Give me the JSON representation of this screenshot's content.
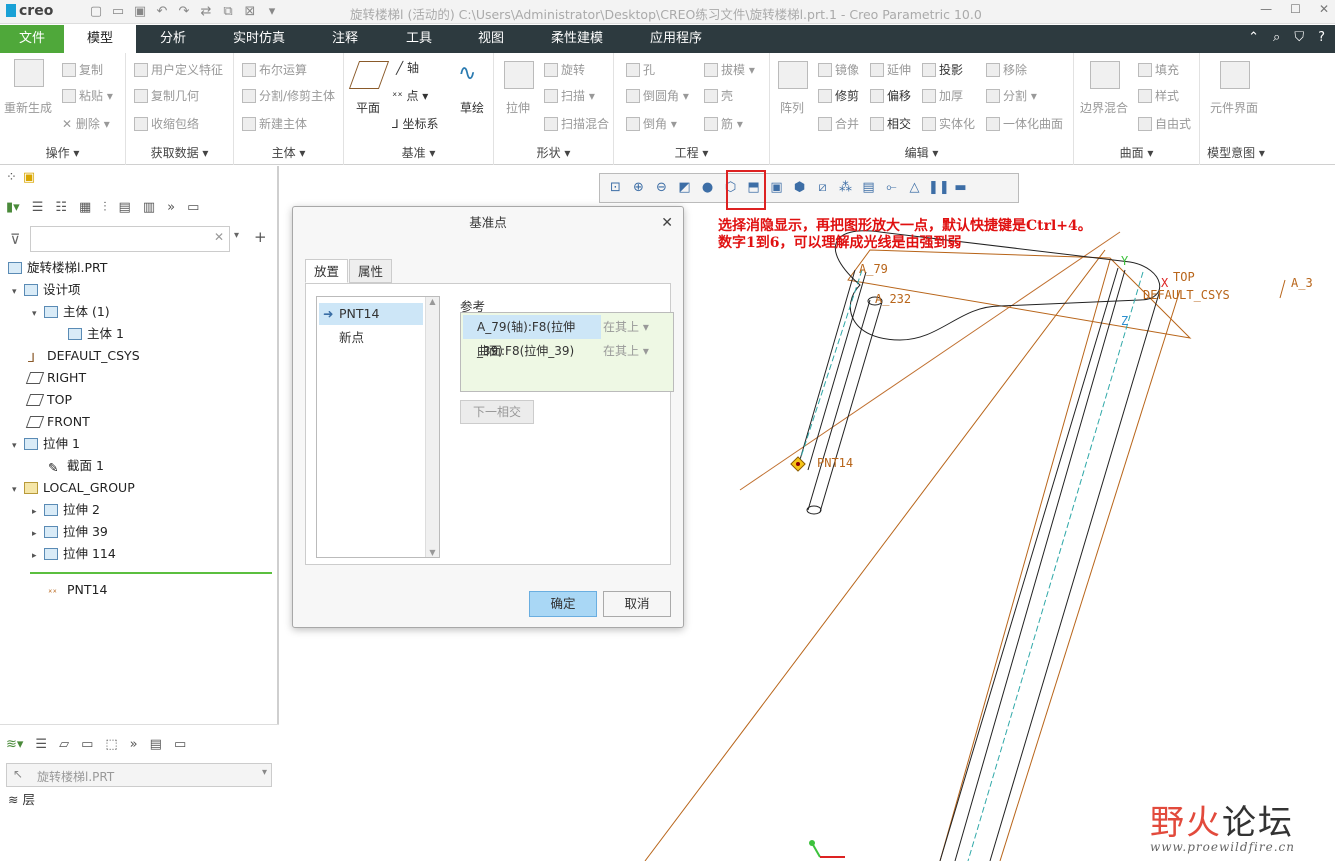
{
  "titlebar": {
    "logo": "creo",
    "title": "旋转楼梯l (活动的) C:\\Users\\Administrator\\Desktop\\CREO练习文件\\旋转楼梯l.prt.1 - Creo Parametric 10.0"
  },
  "menu": {
    "file": "文件",
    "tabs": [
      "模型",
      "分析",
      "实时仿真",
      "注释",
      "工具",
      "视图",
      "柔性建模",
      "应用程序"
    ]
  },
  "ribbon": {
    "ops": {
      "regen": "重新生成",
      "copy": "复制",
      "paste": "粘贴",
      "delete": "删除",
      "title": "操作"
    },
    "getdata": {
      "udf": "用户定义特征",
      "copygeom": "复制几何",
      "shrink": "收缩包络",
      "title": "获取数据"
    },
    "body": {
      "bool": "布尔运算",
      "split": "分割/修剪主体",
      "newbody": "新建主体",
      "title": "主体"
    },
    "datum": {
      "plane": "平面",
      "axis": "轴",
      "point": "点",
      "csys": "坐标系",
      "sketch": "草绘",
      "title": "基准"
    },
    "shape": {
      "extrude": "拉伸",
      "revolve": "旋转",
      "sweep": "扫描",
      "sweepblend": "扫描混合",
      "title": "形状"
    },
    "eng": {
      "hole": "孔",
      "round": "倒圆角",
      "chamfer": "倒角",
      "draft": "拔模",
      "shell": "壳",
      "rib": "筋",
      "title": "工程"
    },
    "edit": {
      "pattern": "阵列",
      "mirror": "镜像",
      "extend": "延伸",
      "project": "投影",
      "trim": "修剪",
      "offset": "偏移",
      "thicken": "加厚",
      "merge": "合并",
      "intersect": "相交",
      "solidify": "实体化",
      "remove": "移除",
      "split": "分割",
      "unify": "一体化曲面",
      "title": "编辑"
    },
    "surface": {
      "boundary": "边界混合",
      "fill": "填充",
      "style": "样式",
      "freeform": "自由式",
      "title": "曲面"
    },
    "intent": {
      "compiface": "元件界面",
      "title": "模型意图"
    }
  },
  "tree": {
    "nodes": [
      "旋转楼梯l.PRT",
      "设计项",
      "主体 (1)",
      "主体 1",
      "DEFAULT_CSYS",
      "RIGHT",
      "TOP",
      "FRONT",
      "拉伸 1",
      "截面 1",
      "LOCAL_GROUP",
      "拉伸 2",
      "拉伸 39",
      "拉伸 114",
      "PNT14"
    ],
    "layer_combo": "旋转楼梯l.PRT",
    "layer_label": "层"
  },
  "dialog": {
    "title": "基准点",
    "tab_place": "放置",
    "tab_props": "属性",
    "points": [
      "PNT14",
      "新点"
    ],
    "ref_label": "参考",
    "refs": [
      {
        "name": "A_79(轴):F8(拉伸_39)",
        "cons": "在其上"
      },
      {
        "name": "曲面:F8(拉伸_39)",
        "cons": "在其上"
      }
    ],
    "next": "下一相交",
    "ok": "确定",
    "cancel": "取消"
  },
  "annotation": {
    "line1": "选择消隐显示，再把图形放大一点，默认快捷键是Ctrl+4。",
    "line2": "数字1到6，可以理解成光线是由强到弱"
  },
  "labels": {
    "a79": "A_79",
    "a232": "A_232",
    "top": "TOP",
    "csys": "DEFAULT_CSYS",
    "a3": "A_3",
    "pnt": "PNT14",
    "y": "Y",
    "z": "Z",
    "x": "X"
  },
  "watermark": {
    "line1a": "野火",
    "line1b": "论坛",
    "line2": "www.proewildfire.cn"
  },
  "colors": {
    "menubar": "#2d3a3f",
    "file_tab": "#4fa83a",
    "annotation": "#e01010",
    "geometry": "#b8651a"
  }
}
